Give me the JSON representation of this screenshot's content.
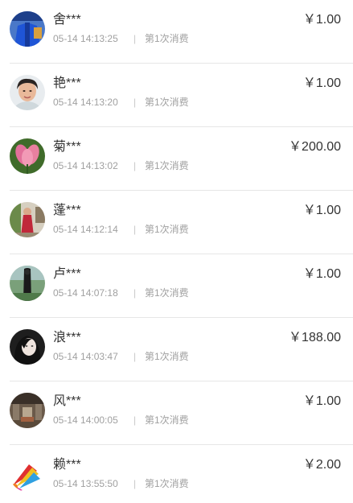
{
  "records": [
    {
      "name": "舍***",
      "time": "05-14 14:13:25",
      "separator": "|",
      "note": "第1次消费",
      "amount": "￥1.00",
      "avatar": "avatar-blue-clothing"
    },
    {
      "name": "艳***",
      "time": "05-14 14:13:20",
      "separator": "|",
      "note": "第1次消费",
      "amount": "￥1.00",
      "avatar": "avatar-portrait-face"
    },
    {
      "name": "菊***",
      "time": "05-14 14:13:02",
      "separator": "|",
      "note": "第1次消费",
      "amount": "￥200.00",
      "avatar": "avatar-pink-lotus"
    },
    {
      "name": "蓬***",
      "time": "05-14 14:12:14",
      "separator": "|",
      "note": "第1次消费",
      "amount": "￥1.00",
      "avatar": "avatar-woman-red-dress"
    },
    {
      "name": "卢***",
      "time": "05-14 14:07:18",
      "separator": "|",
      "note": "第1次消费",
      "amount": "￥1.00",
      "avatar": "avatar-dark-figure-green"
    },
    {
      "name": "浪***",
      "time": "05-14 14:03:47",
      "separator": "|",
      "note": "第1次消费",
      "amount": "￥188.00",
      "avatar": "avatar-woman-dark-hair"
    },
    {
      "name": "风***",
      "time": "05-14 14:00:05",
      "separator": "|",
      "note": "第1次消费",
      "amount": "￥1.00",
      "avatar": "avatar-interior-room"
    },
    {
      "name": "赖***",
      "time": "05-14 13:55:50",
      "separator": "|",
      "note": "第1次消费",
      "amount": "￥2.00",
      "avatar": "avatar-badminton-shuttlecock"
    }
  ]
}
